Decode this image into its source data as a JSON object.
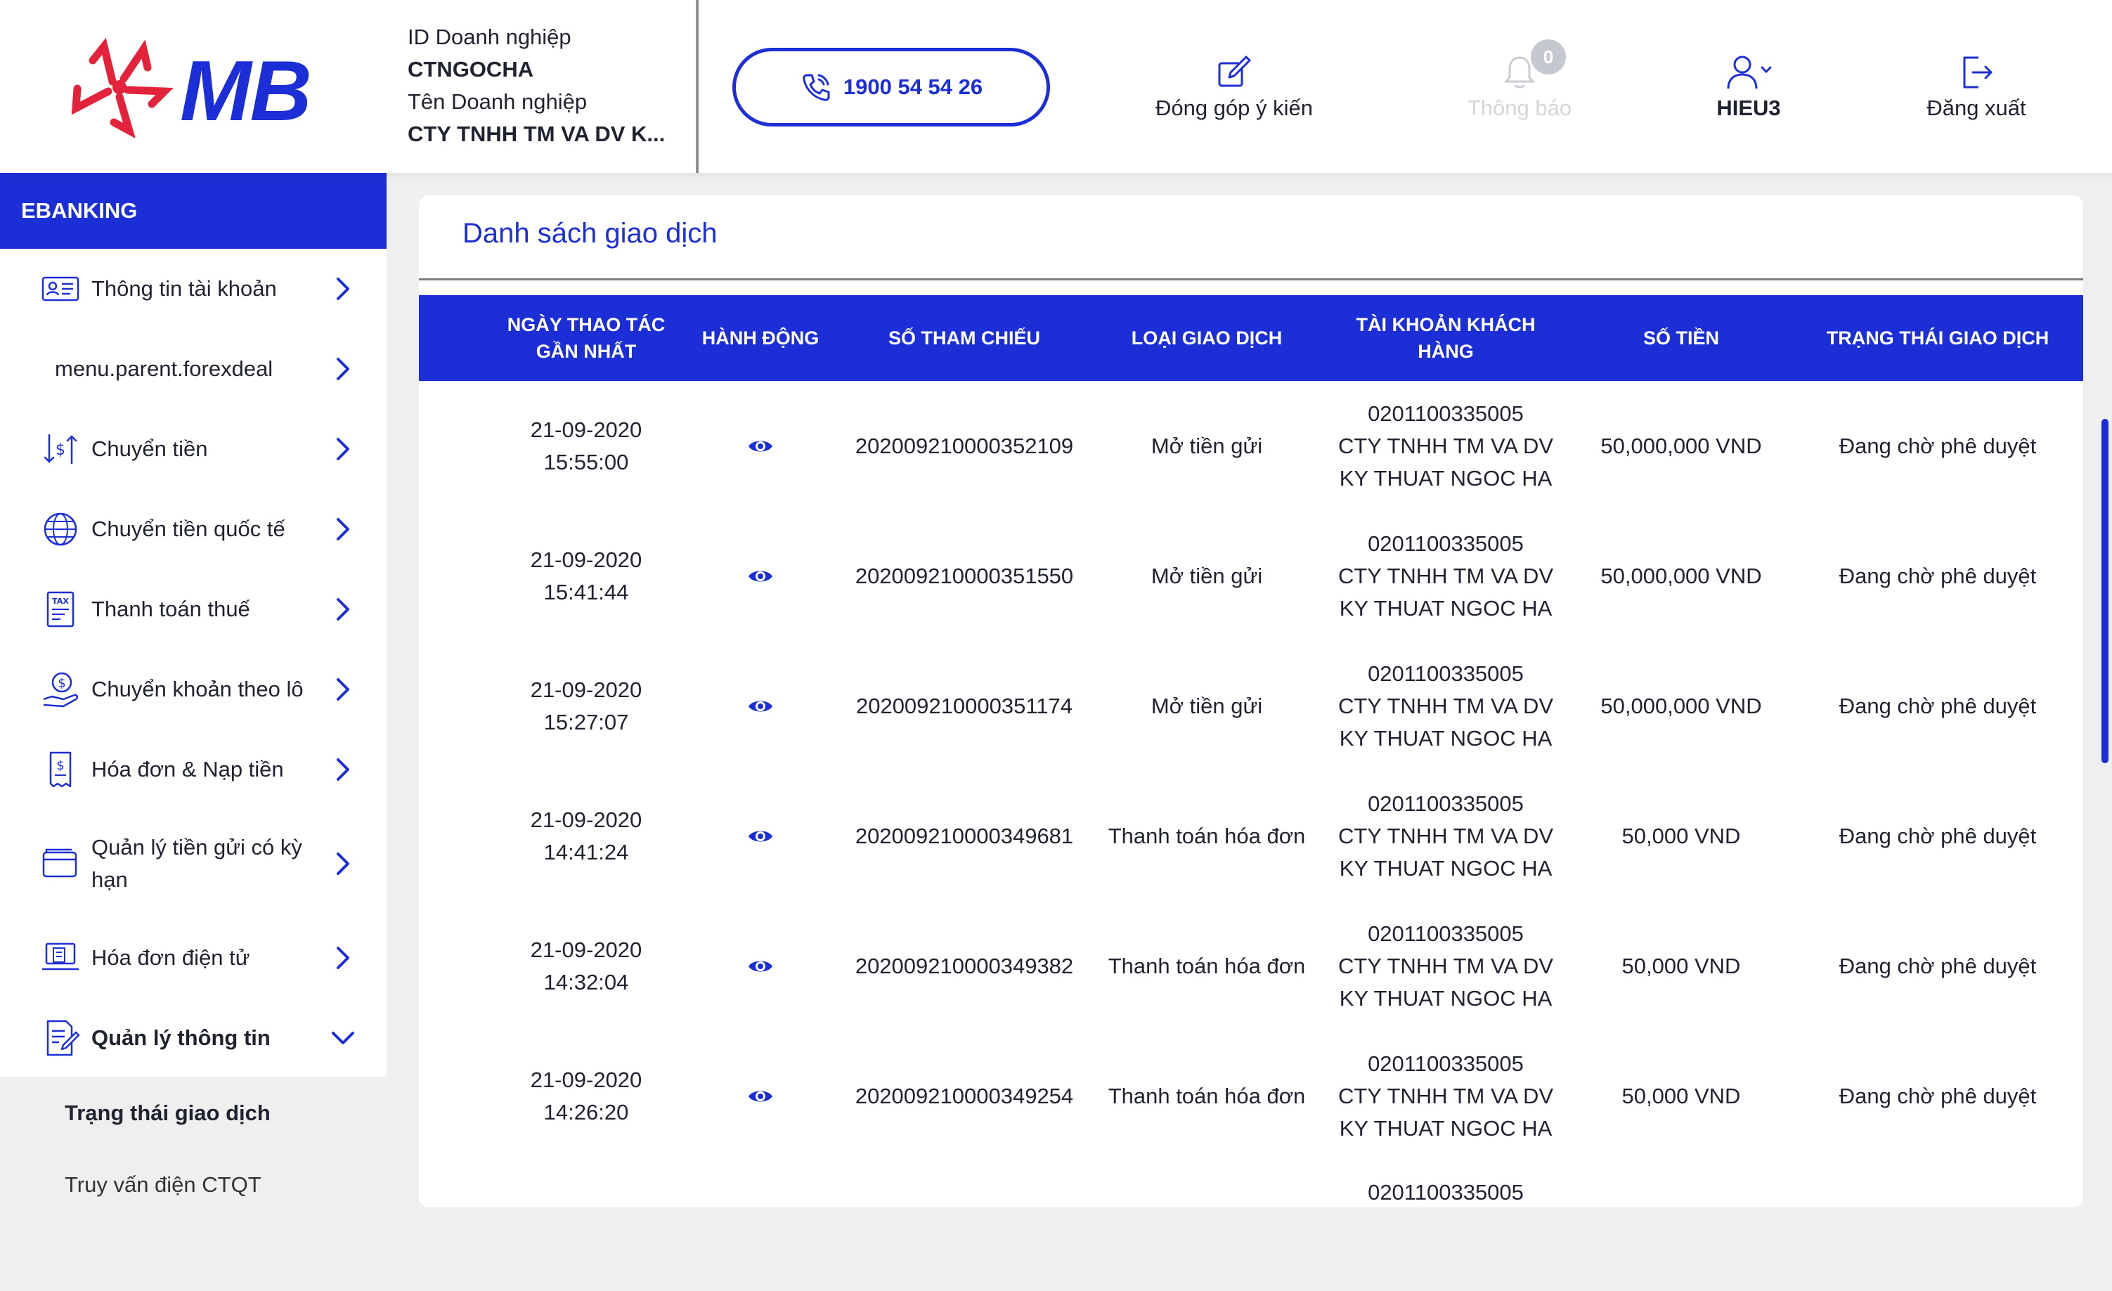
{
  "header": {
    "logo_text": "MB",
    "company_id_label": "ID Doanh nghiệp",
    "company_id": "CTNGOCHA",
    "company_name_label": "Tên Doanh nghiệp",
    "company_name": "CTY TNHH TM VA DV K...",
    "hotline": "1900 54 54 26",
    "feedback_label": "Đóng góp ý kiến",
    "notification_label": "Thông báo",
    "notification_count": "0",
    "username": "HIEU3",
    "logout_label": "Đăng xuất"
  },
  "sidebar": {
    "title": "EBANKING",
    "items": [
      {
        "label": "Thông tin tài khoản",
        "icon": "id-card-icon"
      },
      {
        "label": "menu.parent.forexdeal",
        "icon": ""
      },
      {
        "label": "Chuyển tiền",
        "icon": "money-transfer-icon"
      },
      {
        "label": "Chuyển tiền quốc tế",
        "icon": "globe-icon"
      },
      {
        "label": "Thanh toán thuế",
        "icon": "tax-icon"
      },
      {
        "label": "Chuyển khoản theo lô",
        "icon": "coin-hand-icon"
      },
      {
        "label": "Hóa đơn & Nạp tiền",
        "icon": "receipt-icon"
      },
      {
        "label": "Quản lý tiền gửi có kỳ hạn",
        "icon": "wallet-icon"
      },
      {
        "label": "Hóa đơn điện tử",
        "icon": "laptop-invoice-icon"
      },
      {
        "label": "Quản lý thông tin",
        "icon": "document-edit-icon"
      }
    ],
    "submenu": [
      {
        "label": "Trạng thái giao dịch"
      },
      {
        "label": "Truy vấn điện CTQT"
      }
    ]
  },
  "main": {
    "title": "Danh sách giao dịch",
    "columns": [
      "NGÀY THAO TÁC GẦN NHẤT",
      "HÀNH ĐỘNG",
      "SỐ THAM CHIẾU",
      "LOẠI GIAO DỊCH",
      "TÀI KHOẢN KHÁCH HÀNG",
      "SỐ TIỀN",
      "TRẠNG THÁI GIAO DỊCH"
    ],
    "rows": [
      {
        "date": "21-09-2020",
        "time": "15:55:00",
        "ref": "202009210000352109",
        "type": "Mở tiền gửi",
        "account": "0201100335005",
        "account_name_1": "CTY TNHH TM VA DV",
        "account_name_2": "KY THUAT NGOC HA",
        "amount": "50,000,000 VND",
        "status": "Đang chờ phê duyệt"
      },
      {
        "date": "21-09-2020",
        "time": "15:41:44",
        "ref": "202009210000351550",
        "type": "Mở tiền gửi",
        "account": "0201100335005",
        "account_name_1": "CTY TNHH TM VA DV",
        "account_name_2": "KY THUAT NGOC HA",
        "amount": "50,000,000 VND",
        "status": "Đang chờ phê duyệt"
      },
      {
        "date": "21-09-2020",
        "time": "15:27:07",
        "ref": "202009210000351174",
        "type": "Mở tiền gửi",
        "account": "0201100335005",
        "account_name_1": "CTY TNHH TM VA DV",
        "account_name_2": "KY THUAT NGOC HA",
        "amount": "50,000,000 VND",
        "status": "Đang chờ phê duyệt"
      },
      {
        "date": "21-09-2020",
        "time": "14:41:24",
        "ref": "202009210000349681",
        "type": "Thanh toán hóa đơn",
        "account": "0201100335005",
        "account_name_1": "CTY TNHH TM VA DV",
        "account_name_2": "KY THUAT NGOC HA",
        "amount": "50,000 VND",
        "status": "Đang chờ phê duyệt"
      },
      {
        "date": "21-09-2020",
        "time": "14:32:04",
        "ref": "202009210000349382",
        "type": "Thanh toán hóa đơn",
        "account": "0201100335005",
        "account_name_1": "CTY TNHH TM VA DV",
        "account_name_2": "KY THUAT NGOC HA",
        "amount": "50,000 VND",
        "status": "Đang chờ phê duyệt"
      },
      {
        "date": "21-09-2020",
        "time": "14:26:20",
        "ref": "202009210000349254",
        "type": "Thanh toán hóa đơn",
        "account": "0201100335005",
        "account_name_1": "CTY TNHH TM VA DV",
        "account_name_2": "KY THUAT NGOC HA",
        "amount": "50,000 VND",
        "status": "Đang chờ phê duyệt"
      },
      {
        "account": "0201100335005"
      }
    ]
  },
  "colors": {
    "brand_blue": "#1c2fd6",
    "brand_red": "#e3233b"
  }
}
